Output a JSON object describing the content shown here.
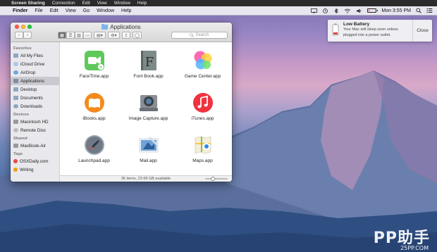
{
  "screen_sharing_bar": {
    "apple": "",
    "app": "Screen Sharing",
    "items": [
      "Connection",
      "Edit",
      "View",
      "Window",
      "Help"
    ]
  },
  "menubar": {
    "apple": "",
    "app": "Finder",
    "items": [
      "File",
      "Edit",
      "View",
      "Go",
      "Window",
      "Help"
    ],
    "clock": "Mon 3:55 PM",
    "battery_level": 0.12
  },
  "finder": {
    "title": "Applications",
    "search_placeholder": "Search",
    "sidebar": {
      "favorites_header": "Favorites",
      "favorites": [
        "All My Files",
        "iCloud Drive",
        "AirDrop",
        "Applications",
        "Desktop",
        "Documents",
        "Downloads"
      ],
      "devices_header": "Devices",
      "devices": [
        "Macintosh HD",
        "Remote Disc"
      ],
      "shared_header": "Shared",
      "shared": [
        "MacBook-Air"
      ],
      "tags_header": "Tags",
      "tags": [
        {
          "label": "OSXDaily.com",
          "color": "#e74c3c"
        },
        {
          "label": "Writing",
          "color": "#f39c12"
        }
      ]
    },
    "apps": [
      {
        "label": "FaceTime.app",
        "icon": "facetime-icon"
      },
      {
        "label": "Font Book.app",
        "icon": "font-book-icon"
      },
      {
        "label": "Game Center.app",
        "icon": "game-center-icon"
      },
      {
        "label": "iBooks.app",
        "icon": "ibooks-icon"
      },
      {
        "label": "Image Capture.app",
        "icon": "image-capture-icon"
      },
      {
        "label": "iTunes.app",
        "icon": "itunes-icon"
      },
      {
        "label": "Launchpad.app",
        "icon": "launchpad-icon"
      },
      {
        "label": "Mail.app",
        "icon": "mail-icon"
      },
      {
        "label": "Maps.app",
        "icon": "maps-icon"
      }
    ],
    "status": "36 items, 23.69 GB available",
    "icon_size_slider": 0.3
  },
  "notification": {
    "title": "Low Battery",
    "text_line1": "Your Mac will sleep soon unless",
    "text_line2": "plugged into a power outlet.",
    "close_label": "Close"
  },
  "watermark": {
    "main": "PP助手",
    "sub": "25PP.COM"
  }
}
